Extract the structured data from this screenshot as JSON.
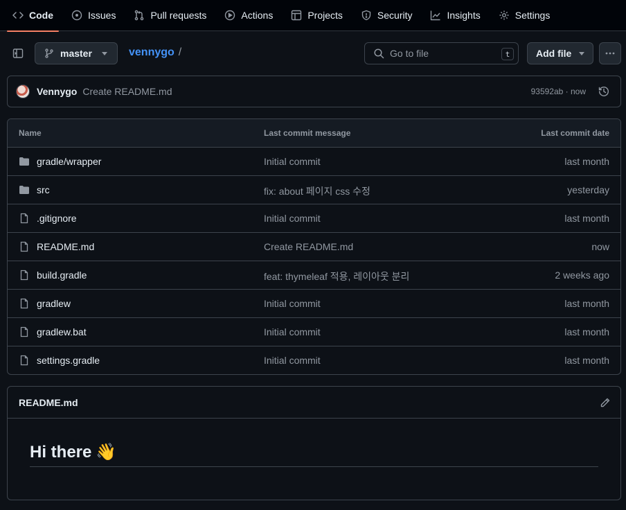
{
  "nav": {
    "tabs": [
      {
        "label": "Code",
        "icon": "code-icon",
        "active": true
      },
      {
        "label": "Issues",
        "icon": "issue-icon"
      },
      {
        "label": "Pull requests",
        "icon": "pull-request-icon"
      },
      {
        "label": "Actions",
        "icon": "play-icon"
      },
      {
        "label": "Projects",
        "icon": "table-icon"
      },
      {
        "label": "Security",
        "icon": "shield-icon"
      },
      {
        "label": "Insights",
        "icon": "graph-icon"
      },
      {
        "label": "Settings",
        "icon": "gear-icon"
      }
    ]
  },
  "toolbar": {
    "branch": "master",
    "repo": "vennygo",
    "separator": "/",
    "goto_placeholder": "Go to file",
    "goto_shortcut": "t",
    "add_file": "Add file"
  },
  "commit": {
    "author": "Vennygo",
    "message": "Create README.md",
    "meta": "93592ab · now"
  },
  "table": {
    "headers": {
      "name": "Name",
      "message": "Last commit message",
      "date": "Last commit date"
    },
    "rows": [
      {
        "type": "folder",
        "name": "gradle/wrapper",
        "message": "Initial commit",
        "date": "last month"
      },
      {
        "type": "folder",
        "name": "src",
        "message": "fix: about 페이지 css 수정",
        "date": "yesterday"
      },
      {
        "type": "file",
        "name": ".gitignore",
        "message": "Initial commit",
        "date": "last month"
      },
      {
        "type": "file",
        "name": "README.md",
        "message": "Create README.md",
        "date": "now"
      },
      {
        "type": "file",
        "name": "build.gradle",
        "message": "feat: thymeleaf 적용, 레이아웃 분리",
        "date": "2 weeks ago"
      },
      {
        "type": "file",
        "name": "gradlew",
        "message": "Initial commit",
        "date": "last month"
      },
      {
        "type": "file",
        "name": "gradlew.bat",
        "message": "Initial commit",
        "date": "last month"
      },
      {
        "type": "file",
        "name": "settings.gradle",
        "message": "Initial commit",
        "date": "last month"
      }
    ]
  },
  "readme": {
    "title": "README.md",
    "heading": "Hi there",
    "emoji": "👋"
  },
  "colors": {
    "background": "#0d1117",
    "border": "#3d444d",
    "accent_link": "#4493f8",
    "active_tab_underline": "#f78166",
    "muted_text": "#9198a1"
  }
}
